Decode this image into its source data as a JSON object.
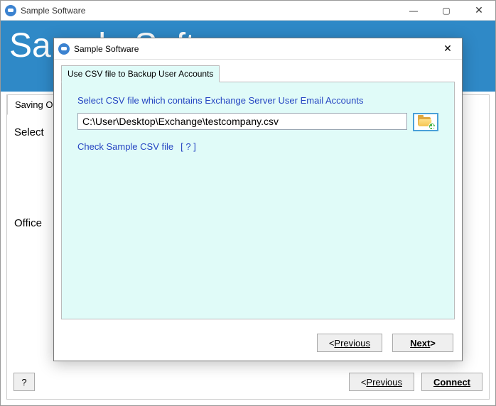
{
  "main": {
    "title": "Sample Software",
    "banner": "Sample Software",
    "bg_tab": "Saving Options",
    "bg_label1": "Select",
    "bg_label2": "Office",
    "help_label": "?",
    "prev_label": "Previous",
    "prev_prefix": "< ",
    "connect_label": "Connect"
  },
  "dialog": {
    "title": "Sample Software",
    "tab": "Use CSV file to Backup User Accounts",
    "instruction": "Select CSV file which contains Exchange Server User Email Accounts",
    "file_path": "C:\\User\\Desktop\\Exchange\\testcompany.csv",
    "sample_link": "Check Sample CSV file",
    "sample_help": "[ ? ]",
    "prev_label": "Previous",
    "prev_prefix": "< ",
    "next_label": "Next",
    "next_suffix": " >"
  }
}
